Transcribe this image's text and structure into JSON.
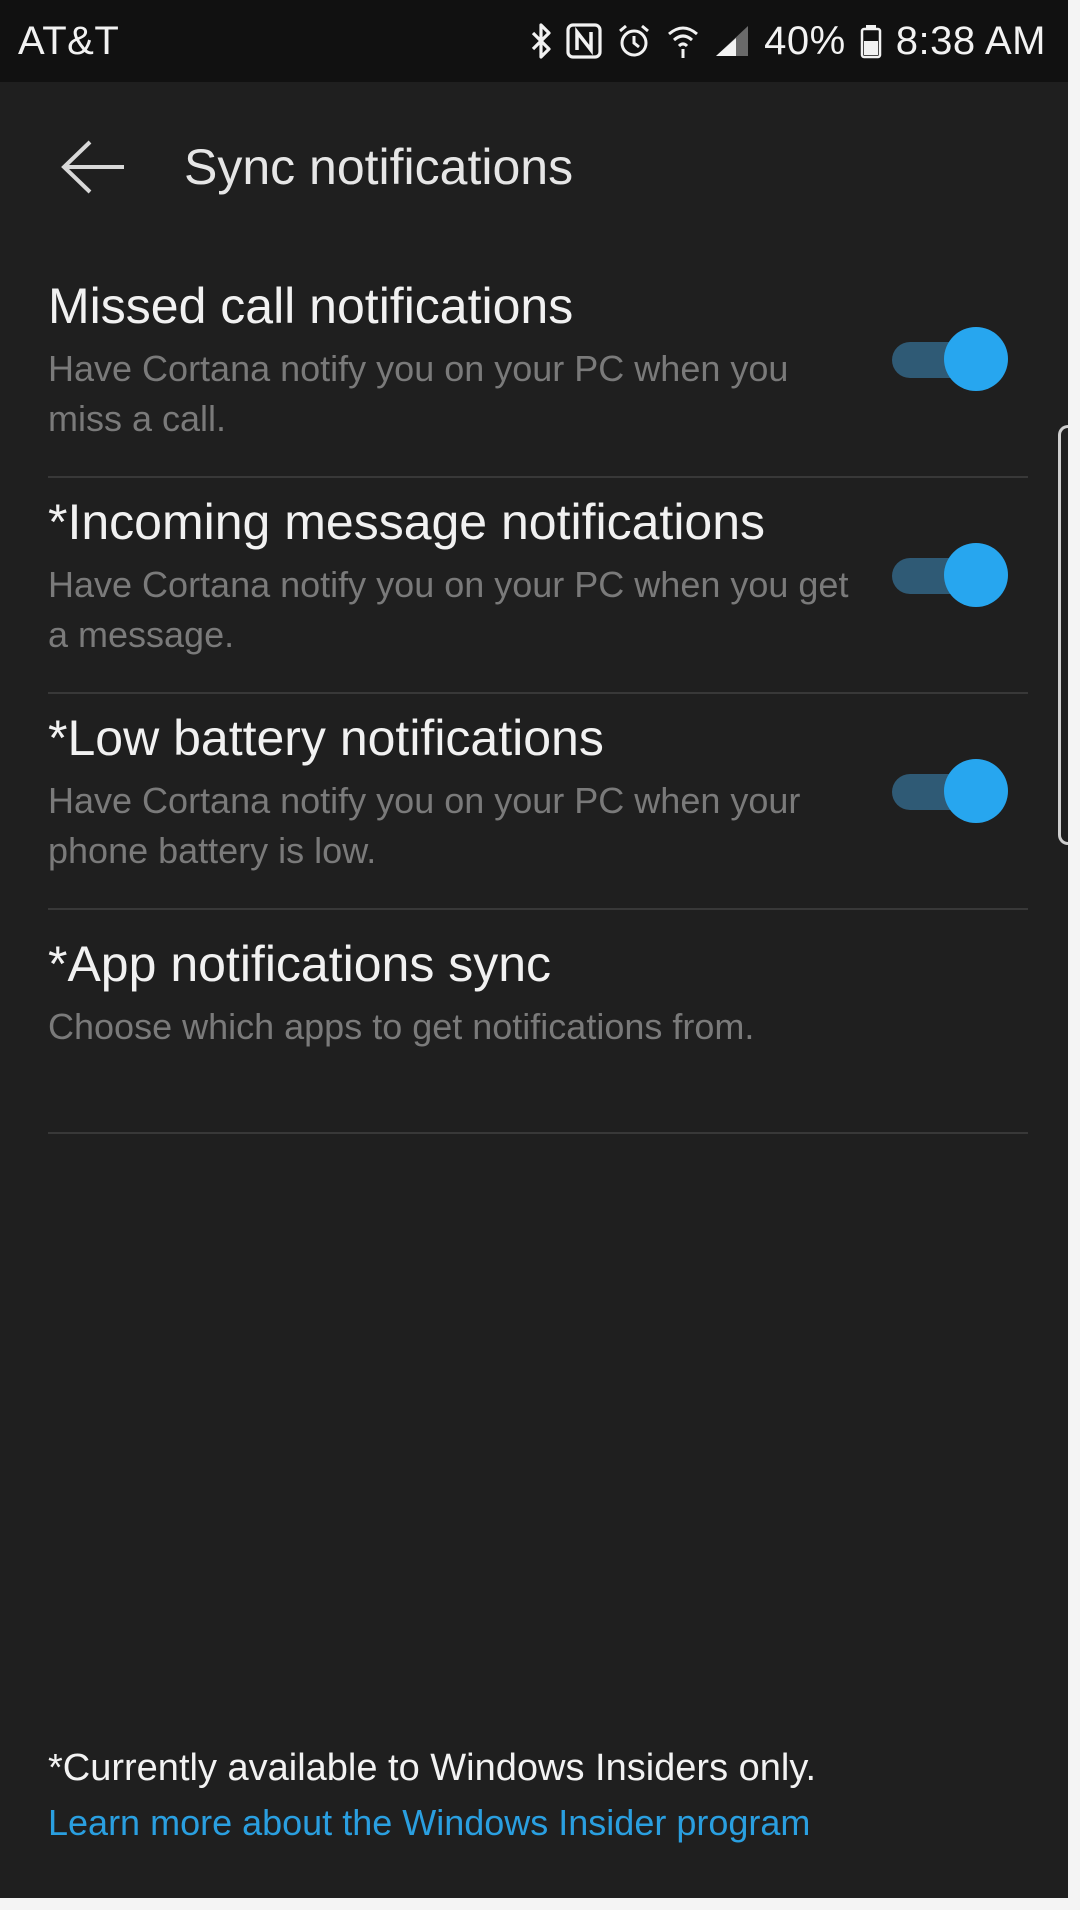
{
  "status_bar": {
    "carrier": "AT&T",
    "battery_percent": "40%",
    "time": "8:38 AM",
    "icons": [
      "bluetooth-icon",
      "nfc-icon",
      "alarm-icon",
      "wifi-icon",
      "cell-signal-icon",
      "battery-icon"
    ]
  },
  "header": {
    "back_icon": "back-arrow-icon",
    "title": "Sync notifications"
  },
  "settings": [
    {
      "title": "Missed call notifications",
      "description": "Have Cortana notify you on your PC when you miss a call.",
      "toggle_on": true
    },
    {
      "title": "*Incoming message notifications",
      "description": "Have Cortana notify you on your PC when you get a message.",
      "toggle_on": true
    },
    {
      "title": "*Low battery notifications",
      "description": "Have Cortana notify you on your PC when your phone battery is low.",
      "toggle_on": true
    },
    {
      "title": "*App notifications sync",
      "description": "Choose which apps to get notifications from."
    }
  ],
  "footer": {
    "note": "*Currently available to Windows Insiders only.",
    "link_label": "Learn more about the Windows Insider program"
  },
  "colors": {
    "background": "#1f1f1f",
    "status_bar": "#111111",
    "accent": "#27a6ef",
    "toggle_track": "#2f5a75",
    "link": "#2a9fe0"
  }
}
